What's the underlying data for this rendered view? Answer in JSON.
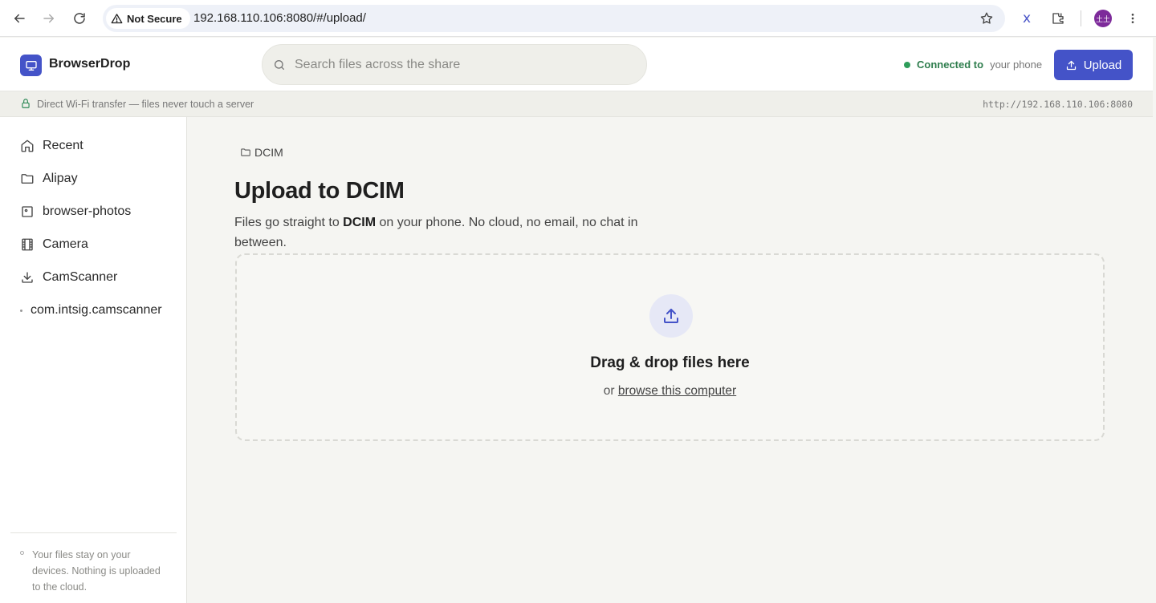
{
  "browser": {
    "security_label": "Not Secure",
    "url": "192.168.110.106:8080/#/upload/",
    "profile_initials": "土土"
  },
  "header": {
    "brand": "BrowserDrop",
    "search_placeholder": "Search files across the share",
    "connection": {
      "status": "Connected to",
      "device": "your phone",
      "status_color": "#2e9d5a"
    },
    "upload_label": "Upload",
    "accent_color": "#4453c8"
  },
  "strip": {
    "message": "Direct Wi-Fi transfer — files never touch a server",
    "server_url": "http://192.168.110.106:8080"
  },
  "sidebar": {
    "items": [
      {
        "label": "Recent",
        "icon": "home-icon"
      },
      {
        "label": "Alipay",
        "icon": "folder-icon"
      },
      {
        "label": "browser-photos",
        "icon": "image-icon"
      },
      {
        "label": "Camera",
        "icon": "film-icon"
      },
      {
        "label": "CamScanner",
        "icon": "download-icon"
      },
      {
        "label": "com.intsig.camscanner",
        "icon": "dot-icon"
      }
    ],
    "footer": "Your files stay on your devices. Nothing is uploaded to the cloud."
  },
  "main": {
    "breadcrumb": "DCIM",
    "title": "Upload to DCIM",
    "description": {
      "before": "Files go straight to ",
      "folder": "DCIM",
      "after": " on your phone. No cloud, no email, no chat in between."
    },
    "dropzone": {
      "title": "Drag & drop files here",
      "prefix": "or ",
      "link": "browse this computer"
    }
  }
}
